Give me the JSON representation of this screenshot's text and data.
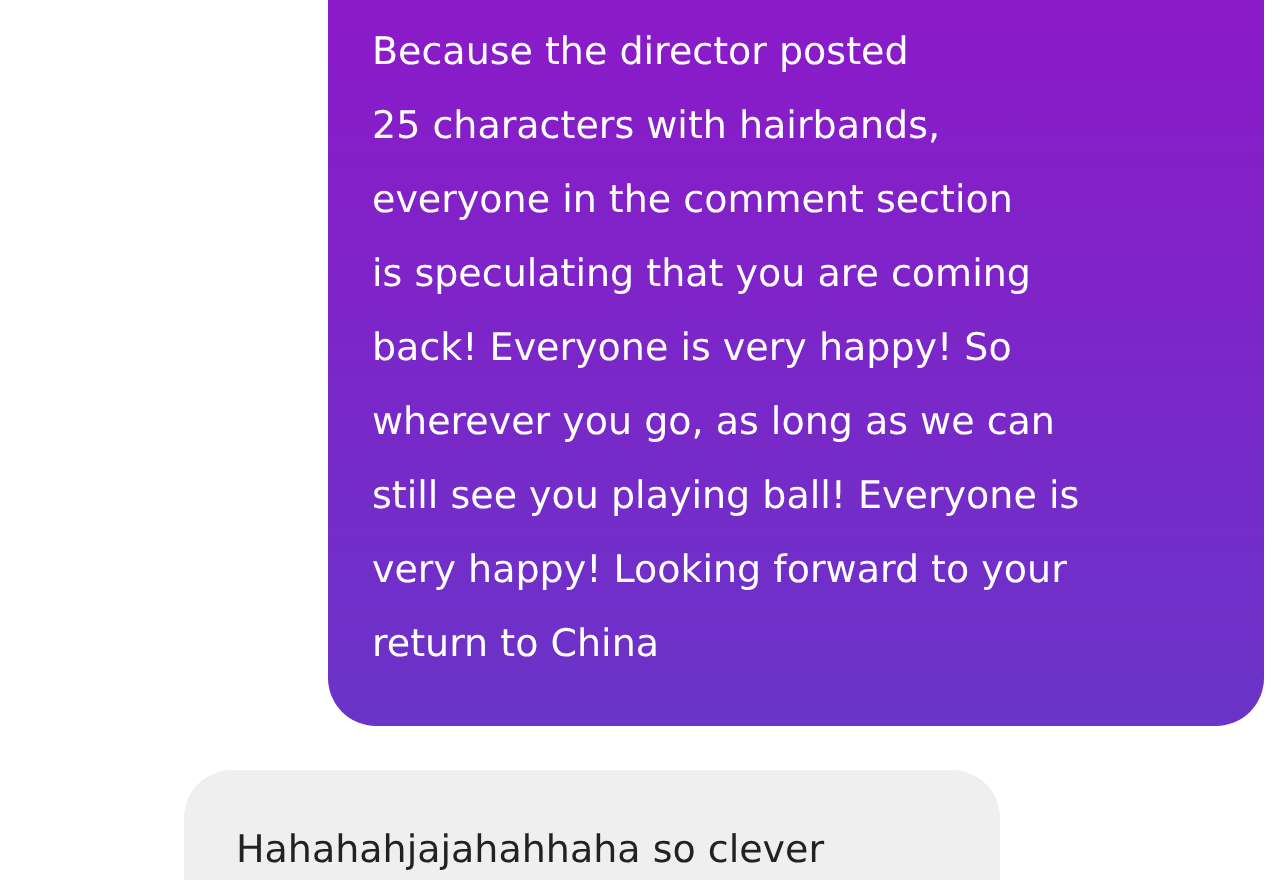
{
  "messages": [
    {
      "kind": "outgoing",
      "text": "Because the director posted\n25 characters with hairbands,\neveryone in the comment section\nis speculating that you are coming\nback! Everyone is very happy! So\nwherever you go, as long as we can\nstill see you playing ball! Everyone is\nvery happy! Looking forward to your\nreturn to China"
    },
    {
      "kind": "incoming",
      "text": "Hahahahjajahahhaha so clever"
    }
  ]
}
